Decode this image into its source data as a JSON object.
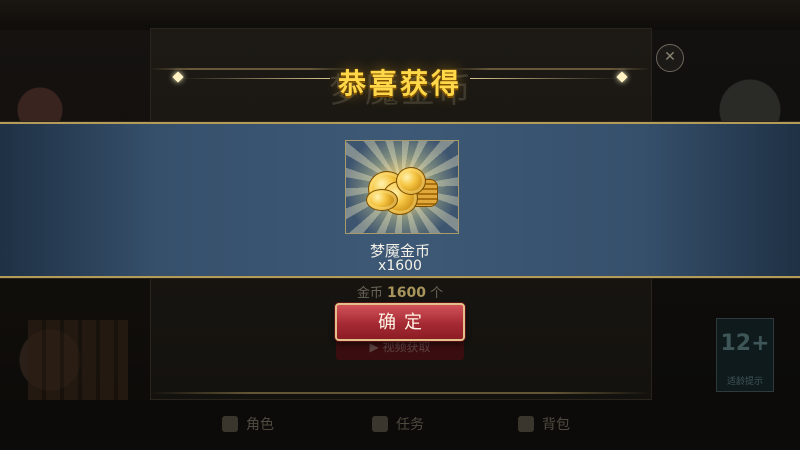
{
  "background": {
    "panel_title": "梦魇金币",
    "cost_label": "金币",
    "cost_amount": "1600",
    "cost_unit": "个",
    "video_button_label": "视频获取",
    "age_rating": "12+",
    "age_rating_label": "适龄提示",
    "bottom_nav": [
      {
        "label": "角色",
        "icon": "character-icon"
      },
      {
        "label": "任务",
        "icon": "quest-icon"
      },
      {
        "label": "背包",
        "icon": "backpack-icon"
      }
    ]
  },
  "dialog": {
    "title": "恭喜获得",
    "item": {
      "name": "梦魇金币",
      "quantity": "x1600",
      "icon": "gold-coin-pile-icon"
    },
    "confirm_label": "确定"
  },
  "colors": {
    "title_gold": "#ffd84a",
    "banner_blue": "#3d5976",
    "border_gold": "#b49b5c",
    "button_red": "#a52a33"
  }
}
